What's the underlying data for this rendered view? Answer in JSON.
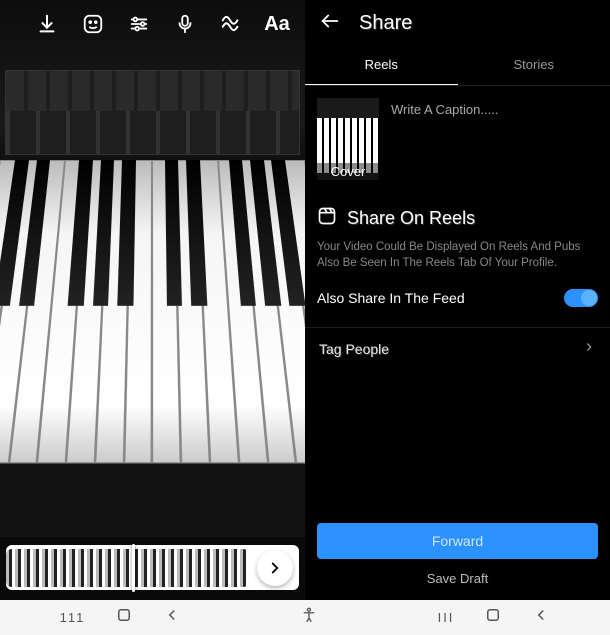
{
  "left_pane": {
    "toolbar": {
      "download_name": "download-icon",
      "sticker_name": "sticker-icon",
      "sliders_name": "sliders-icon",
      "mic_name": "mic-icon",
      "effects_name": "effects-icon",
      "text_label": "Aa"
    },
    "timeline": {
      "next_name": "chevron-right-icon"
    }
  },
  "right_pane": {
    "header_title": "Share",
    "tabs": {
      "reels": "Reels",
      "stories": "Stories"
    },
    "cover_label": "Cover",
    "caption_placeholder": "Write A Caption.....",
    "share_reels_title": "Share On Reels",
    "share_reels_desc": "Your Video Could Be Displayed On Reels And Pubs Also Be Seen In The Reels Tab Of Your Profile.",
    "also_share_label": "Also Share In The Feed",
    "also_share_value": true,
    "tag_people_label": "Tag People",
    "forward_label": "Forward",
    "save_draft_label": "Save Draft"
  },
  "sys_nav": {
    "recents_left": "111",
    "recents_right": "III"
  },
  "colors": {
    "accent": "#2b92ff"
  }
}
